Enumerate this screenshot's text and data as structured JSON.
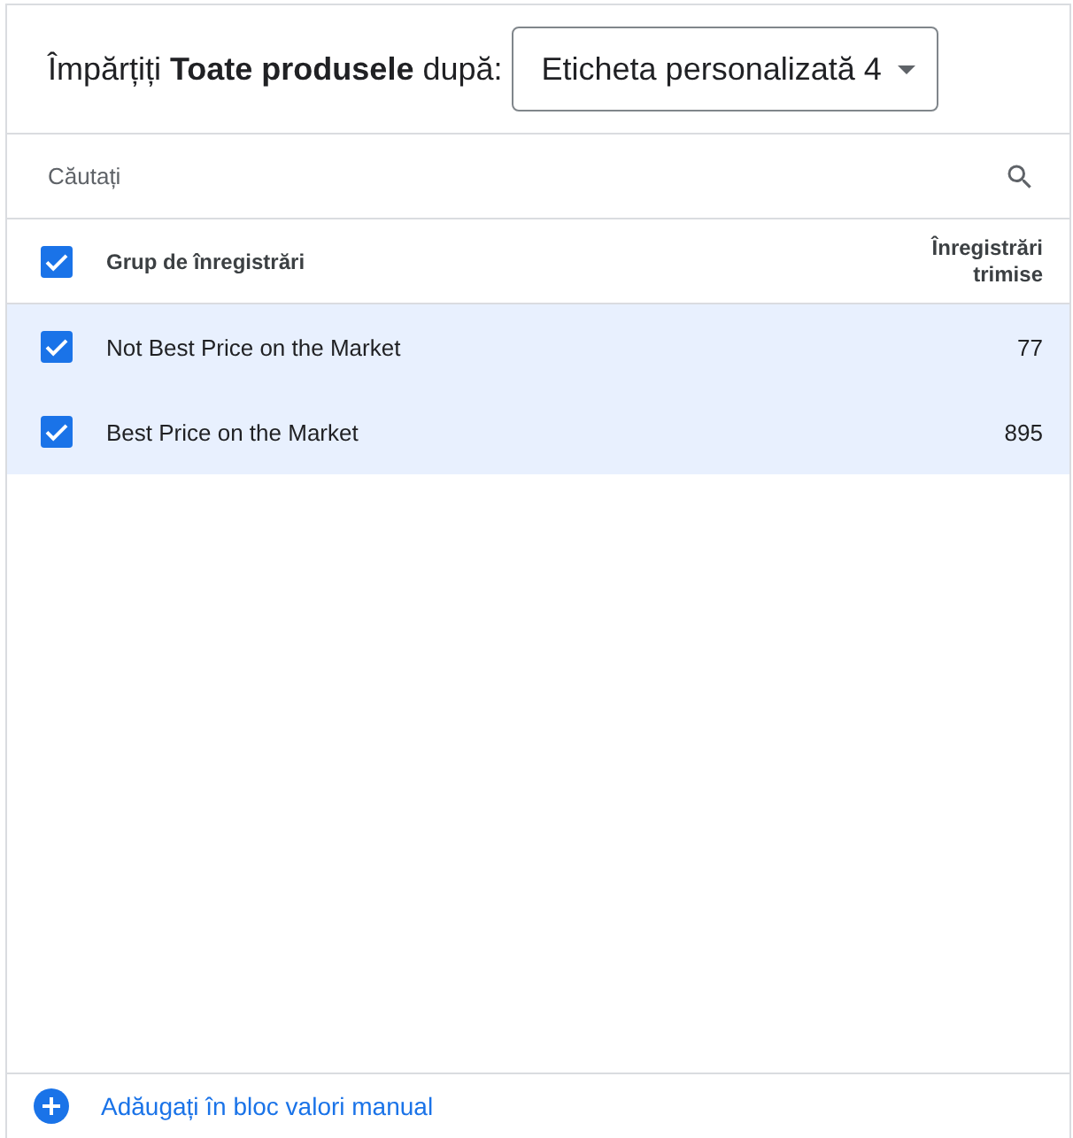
{
  "header": {
    "title": "Împărțiți **Toate produsele** după:",
    "dropdown": {
      "value": "Eticheta personalizată 4"
    }
  },
  "search": {
    "placeholder": "Căutați"
  },
  "table": {
    "select_all": {
      "checked": true
    },
    "columns": [
      "Grup de înregistrări",
      "Înregistrări trimise"
    ],
    "rows": [
      {
        "name": "Not Best Price on the Market",
        "count": "77",
        "checked": true
      },
      {
        "name": "Best Price on the Market",
        "count": "895",
        "checked": true
      }
    ]
  },
  "footer": {
    "link": "Adăugați în bloc valori manual"
  }
}
